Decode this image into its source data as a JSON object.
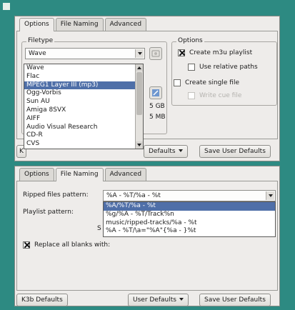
{
  "top_window": {
    "tabs": [
      "Options",
      "File Naming",
      "Advanced"
    ],
    "filetype_group": {
      "title": "Filetype",
      "selected": "Wave",
      "list_items": [
        "Wave",
        "Flac",
        "MPEG1 Layer III (mp3)",
        "Ogg-Vorbis",
        "Sun AU",
        "Amiga 8SVX",
        "AIFF",
        "Audio Visual Research",
        "CD-R",
        "CVS"
      ],
      "selected_index": 2
    },
    "options_group": {
      "title": "Options",
      "create_m3u": "Create m3u playlist",
      "use_relative": "Use relative paths",
      "create_single": "Create single file",
      "write_cue": "Write cue file"
    },
    "partial_size_1": "5 GB",
    "partial_size_2": "5 MB",
    "defaults_partial": "Defaults",
    "save_user_defaults": "Save User Defaults",
    "left_button_partial": "K"
  },
  "bottom_window": {
    "tabs": [
      "Options",
      "File Naming",
      "Advanced"
    ],
    "ripped_label": "Ripped files pattern:",
    "ripped_value": "%A - %T/%a - %t",
    "playlist_label": "Playlist pattern:",
    "pattern_options": [
      "%A/%T/%a - %t",
      "%g/%A - %T/Track%n",
      "music/ripped-tracks/%a - %t",
      "%A - %T/\\a=\"%A\"{%a - }%t"
    ],
    "selected_pattern_index": 0,
    "partial_s": "S",
    "replace_blanks": "Replace all blanks with:",
    "k3b_defaults": "K3b Defaults",
    "user_defaults": "User Defaults",
    "save_user_defaults": "Save User Defaults"
  }
}
